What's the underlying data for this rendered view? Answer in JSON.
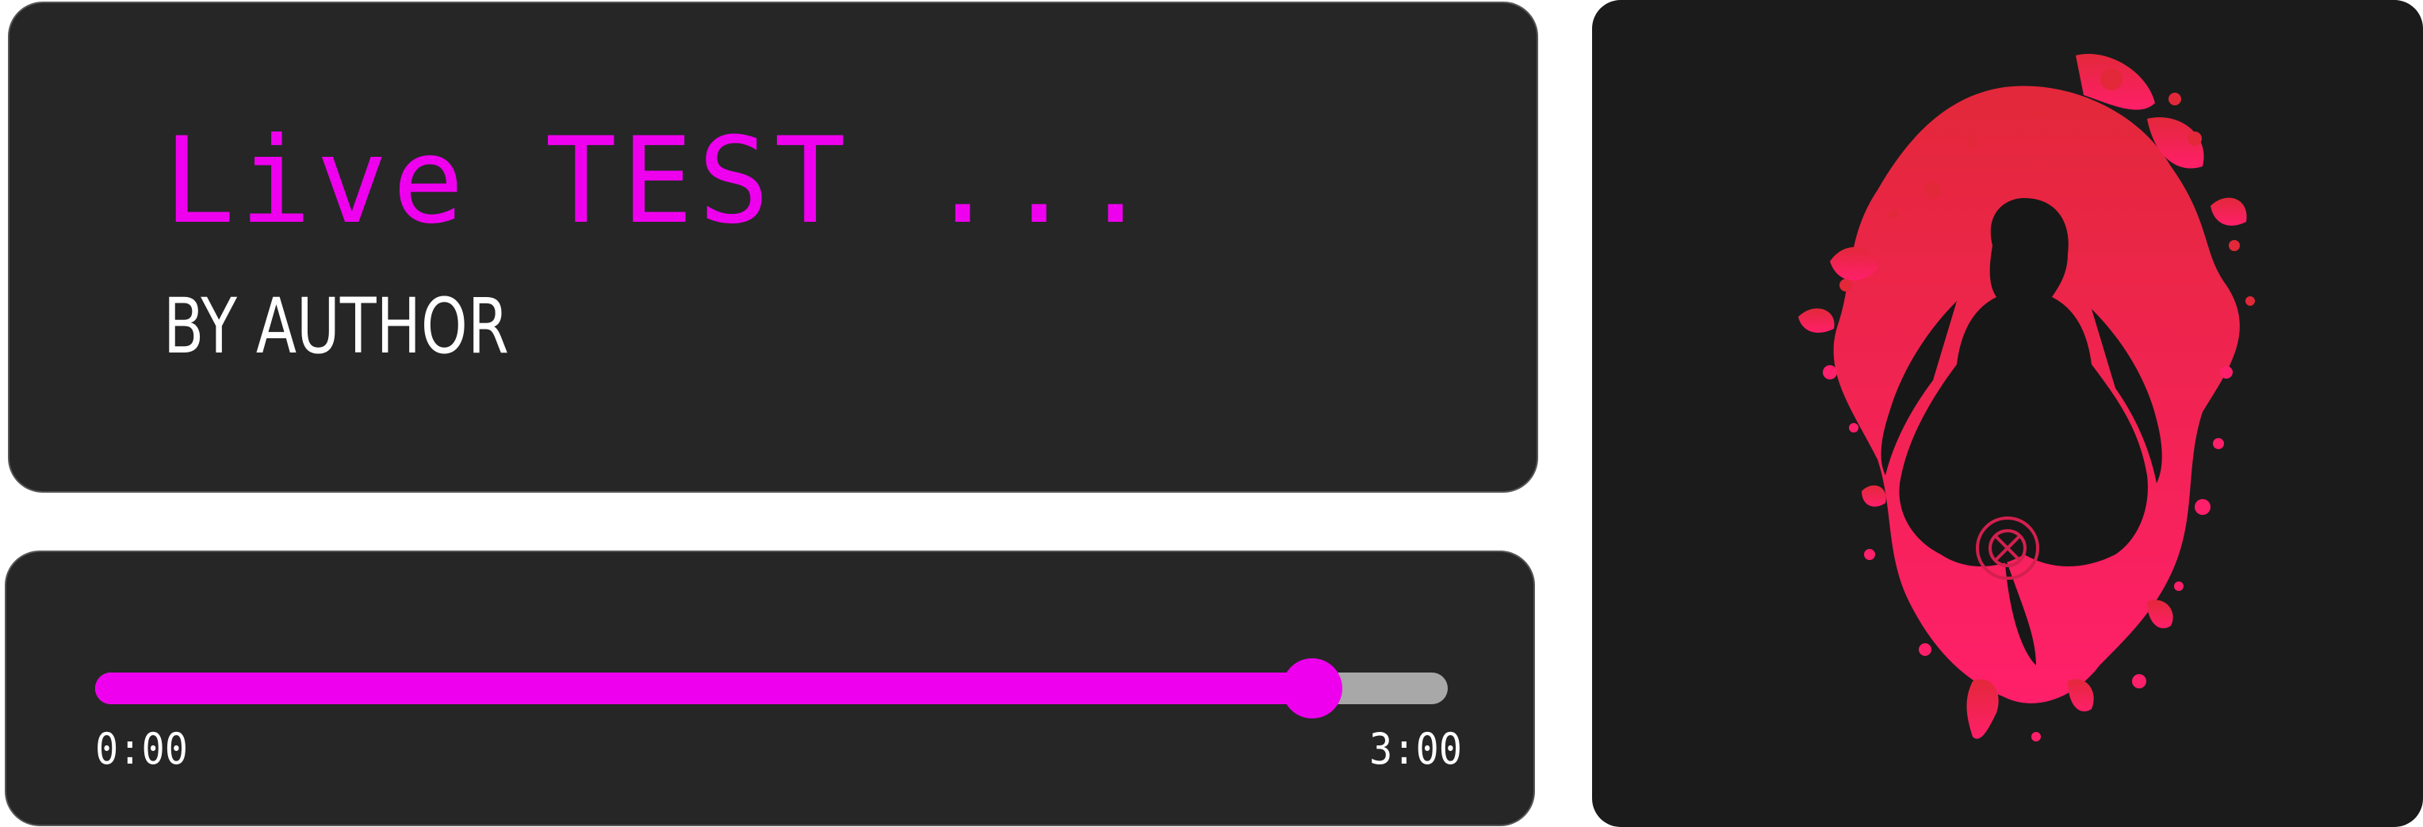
{
  "track": {
    "title": "Live TEST ...",
    "author": "BY AUTHOR"
  },
  "player": {
    "current_time": "0:00",
    "total_time": "3:00",
    "progress": 0.9
  },
  "artwork": {
    "icon": "anime-silhouette-splatter-art"
  },
  "colors": {
    "accent": "#ee00ee",
    "card_background": "#262626",
    "artwork_background": "#1b1b1b",
    "track_remaining": "#a8a8a8",
    "text": "#ffffff",
    "splatter_top": "#e3283a",
    "splatter_bottom": "#ff1f6a"
  }
}
